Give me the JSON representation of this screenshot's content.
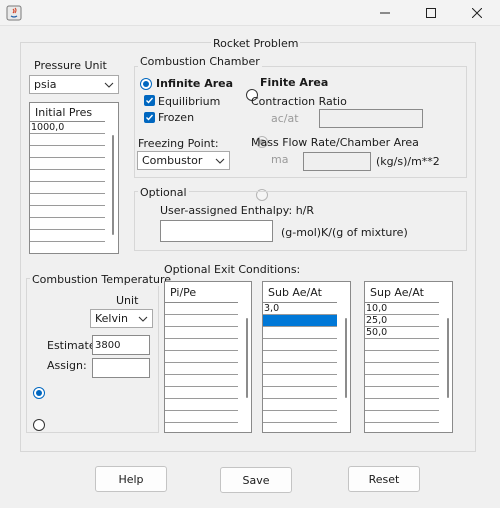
{
  "window": {
    "title": "",
    "icon": "java-app-icon"
  },
  "panel_title": "Rocket Problem",
  "pressure": {
    "label": "Pressure Unit",
    "unit": "psia",
    "list_header": "Initial Pres",
    "values": [
      "1000,0",
      "",
      "",
      "",
      "",
      "",
      "",
      "",
      "",
      "",
      ""
    ]
  },
  "combustion_chamber": {
    "title": "Combustion Chamber",
    "infinite_area": "Infinite Area",
    "finite_area": "Finite Area",
    "equilibrium": "Equilibrium",
    "frozen": "Frozen",
    "contraction_ratio": "Contraction Ratio",
    "ac_at": "ac/at",
    "freezing_point": "Freezing Point:",
    "freezing_value": "Combustor",
    "mass_flow_label": "Mass Flow Rate/Chamber Area",
    "ma": "ma",
    "mass_flow_unit": "(kg/s)/m**2",
    "selected_area": "infinite",
    "equilibrium_checked": true,
    "frozen_checked": true
  },
  "optional": {
    "title": "Optional",
    "enthalpy_label": "User-assigned Enthalpy: h/R",
    "enthalpy_unit": "(g-mol)K/(g of mixture)",
    "enthalpy_value": ""
  },
  "combustion_temp": {
    "title": "Combustion Temperature",
    "unit_label": "Unit",
    "unit": "Kelvin",
    "estimate_label": "Estimate:",
    "estimate_value": "3800",
    "assign_label": "Assign:",
    "assign_value": "",
    "selected": "estimate"
  },
  "exit_conditions": {
    "title": "Optional Exit Conditions:",
    "pi_pe": {
      "header": "Pi/Pe",
      "values": [
        "",
        "",
        "",
        "",
        "",
        "",
        "",
        "",
        "",
        ""
      ]
    },
    "sub_ae_at": {
      "header": "Sub Ae/At",
      "values": [
        "3,0",
        "",
        "",
        "",
        "",
        "",
        "",
        "",
        "",
        ""
      ],
      "selected_row": 1
    },
    "sup_ae_at": {
      "header": "Sup Ae/At",
      "values": [
        "10,0",
        "25,0",
        "50,0",
        "",
        "",
        "",
        "",
        "",
        "",
        ""
      ]
    }
  },
  "buttons": {
    "help": "Help",
    "save": "Save",
    "reset": "Reset"
  },
  "colors": {
    "accent": "#0067c0",
    "selection": "#0078d7",
    "background": "#f0f0f0"
  }
}
